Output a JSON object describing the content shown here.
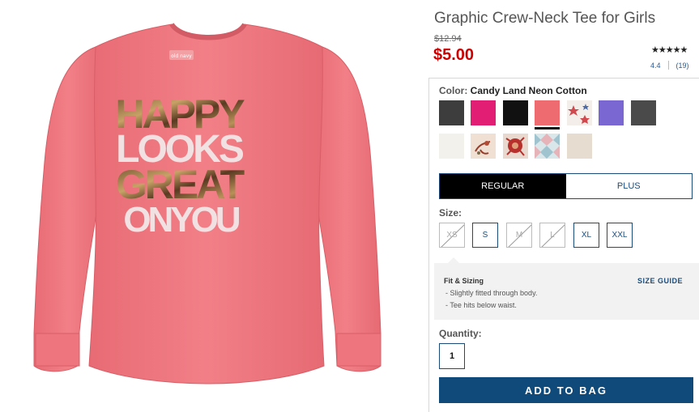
{
  "product": {
    "title": "Graphic Crew-Neck Tee for Girls",
    "old_price": "$12.94",
    "price": "$5.00",
    "rating_value": "4.4",
    "review_count": "(19)",
    "stars": "★★★★★",
    "image_alt": "Pink long-sleeve tee printed HAPPY LOOKS GREAT ON YOU",
    "print_text": [
      "HAPPY",
      "LOOKS",
      "GREAT",
      "ONYOU"
    ],
    "tag_text": "old navy"
  },
  "color": {
    "label": "Color:",
    "selected": "Candy Land Neon Cotton",
    "swatches": [
      {
        "name": "charcoal",
        "hex": "#3d3d3d"
      },
      {
        "name": "magenta",
        "hex": "#e21d74"
      },
      {
        "name": "black",
        "hex": "#111111"
      },
      {
        "name": "candy-land-neon",
        "hex": "#ee6b6f",
        "selected": true
      },
      {
        "name": "star-print",
        "hex": "#f4eeea"
      },
      {
        "name": "purple",
        "hex": "#7b67d2"
      },
      {
        "name": "dark-heather",
        "hex": "#4a4a4a"
      },
      {
        "name": "cream",
        "hex": "#f3f1ec"
      },
      {
        "name": "floral-print",
        "hex": "#efe0d3"
      },
      {
        "name": "red-floral",
        "hex": "#e9d8cd"
      },
      {
        "name": "geo-print",
        "hex": "#d9e6ea"
      },
      {
        "name": "oatmeal",
        "hex": "#e6ddd0"
      }
    ]
  },
  "fit": {
    "options": [
      "REGULAR",
      "PLUS"
    ],
    "selected": "REGULAR"
  },
  "size": {
    "label": "Size:",
    "options": [
      {
        "label": "XS",
        "available": false
      },
      {
        "label": "S",
        "available": true
      },
      {
        "label": "M",
        "available": false
      },
      {
        "label": "L",
        "available": false
      },
      {
        "label": "XL",
        "available": true
      },
      {
        "label": "XXL",
        "available": true
      }
    ]
  },
  "fit_sizing": {
    "title": "Fit & Sizing",
    "guide_link": "SIZE GUIDE",
    "lines": [
      "- Slightly fitted through body.",
      "- Tee hits below waist."
    ]
  },
  "quantity": {
    "label": "Quantity:",
    "value": "1"
  },
  "cta": {
    "add_to_bag": "ADD TO BAG"
  },
  "colors": {
    "price_red": "#cc0000",
    "brand_blue": "#0f4a7a",
    "shirt_pink": "#f07a82"
  }
}
